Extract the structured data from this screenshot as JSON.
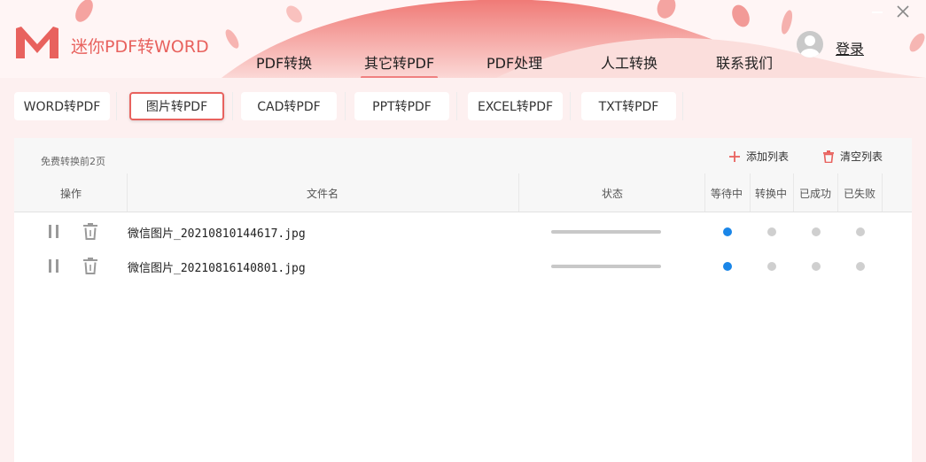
{
  "app": {
    "title": "迷你PDF转WORD"
  },
  "nav": [
    {
      "label": "PDF转换",
      "active": false
    },
    {
      "label": "其它转PDF",
      "active": true
    },
    {
      "label": "PDF处理",
      "active": false
    },
    {
      "label": "人工转换",
      "active": false
    },
    {
      "label": "联系我们",
      "active": false
    }
  ],
  "user": {
    "login_label": "登录"
  },
  "subtabs": [
    {
      "label": "WORD转PDF",
      "active": false
    },
    {
      "label": "图片转PDF",
      "active": true
    },
    {
      "label": "CAD转PDF",
      "active": false
    },
    {
      "label": "PPT转PDF",
      "active": false
    },
    {
      "label": "EXCEL转PDF",
      "active": false
    },
    {
      "label": "TXT转PDF",
      "active": false
    }
  ],
  "panel": {
    "free_note": "免费转换前2页",
    "add_list_label": "添加列表",
    "clear_list_label": "清空列表"
  },
  "table": {
    "columns": {
      "operation": "操作",
      "filename": "文件名",
      "status": "状态",
      "waiting": "等待中",
      "converting": "转换中",
      "succeeded": "已成功",
      "failed": "已失败"
    },
    "rows": [
      {
        "filename": "微信图片_20210810144617.jpg",
        "progress": 0,
        "state": "waiting"
      },
      {
        "filename": "微信图片_20210816140801.jpg",
        "progress": 0,
        "state": "waiting"
      }
    ]
  },
  "colors": {
    "accent": "#e8625e",
    "active_dot": "#1a86e8",
    "inactive_dot": "#cfcfcf",
    "panel_bg": "#fdf0f0"
  }
}
